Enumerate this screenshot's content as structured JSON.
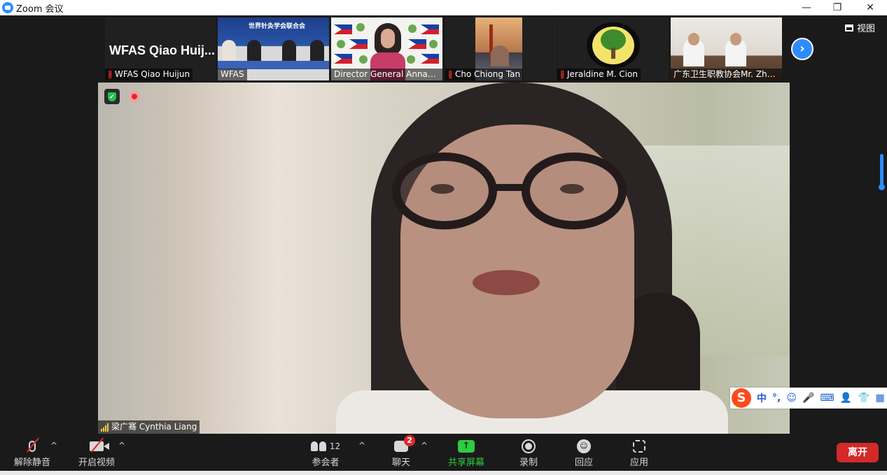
{
  "window": {
    "title": "Zoom 会议",
    "minimize": "—",
    "restore": "❐",
    "close": "✕"
  },
  "view_button": {
    "label": "视图"
  },
  "participants_strip": [
    {
      "name": "WFAS Qiao Huijun",
      "big_name": "WFAS Qiao Huij...",
      "muted": true,
      "video": false
    },
    {
      "name": "WFAS",
      "muted": false,
      "video": true,
      "org_text": "世界针灸学会联合会"
    },
    {
      "name": "Director General Annabel...",
      "muted": false,
      "video": true
    },
    {
      "name": "Cho Chiong Tan",
      "muted": true,
      "video": true
    },
    {
      "name": "Jeraldine M. Cion",
      "muted": true,
      "video": true
    },
    {
      "name": "广东卫生职教协会Mr. Zha...",
      "muted": false,
      "video": true
    }
  ],
  "next_page_icon": "›",
  "main_video": {
    "speaker_label": "梁广骞 Cynthia Liang"
  },
  "ime_toolbar": {
    "logo": "S",
    "items": [
      "中",
      "°,",
      "☺",
      "🎤",
      "⌨",
      "👤",
      "👕",
      "▦"
    ]
  },
  "toolbar": {
    "unmute": {
      "label": "解除静音"
    },
    "start_video": {
      "label": "开启视频"
    },
    "participants": {
      "label": "参会者",
      "count": "12"
    },
    "chat": {
      "label": "聊天",
      "badge": "2"
    },
    "share": {
      "label": "共享屏幕",
      "icon": "↑"
    },
    "record": {
      "label": "录制"
    },
    "reactions": {
      "label": "回应",
      "icon": "☺"
    },
    "apps": {
      "label": "应用"
    },
    "leave": {
      "label": "离开"
    },
    "caret": "^"
  },
  "colors": {
    "accent": "#2d8cff",
    "danger": "#d32929",
    "share_green": "#2ecc40",
    "background": "#1a1a1a"
  }
}
